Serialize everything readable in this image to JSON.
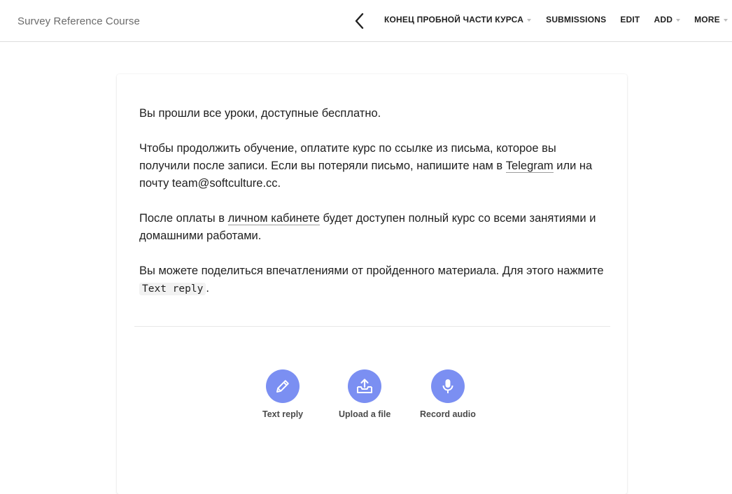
{
  "header": {
    "course_title": "Survey Reference Course",
    "back_icon": "chevron-left-icon",
    "nav": {
      "lesson": "КОНЕЦ ПРОБНОЙ ЧАСТИ КУРСА",
      "submissions": "SUBMISSIONS",
      "edit": "EDIT",
      "add": "ADD",
      "more": "MORE"
    }
  },
  "content": {
    "p1": "Вы прошли все уроки, доступные бесплатно.",
    "p2_before": "Чтобы продолжить обучение, оплатите курс по ссылке из письма, которое вы получили после записи. Если вы потеряли письмо, напишите нам в ",
    "p2_link": "Telegram",
    "p2_after": " или на почту team@softculture.cc.",
    "p3_before": "После оплаты в ",
    "p3_link": "личном кабинете",
    "p3_after": " будет доступен полный курс со всеми занятиями и домашними работами.",
    "p4_before": "Вы можете поделиться впечатлениями от пройденного материала. Для этого нажмите ",
    "p4_code": "Text reply",
    "p4_after": "."
  },
  "actions": {
    "text_reply": "Text reply",
    "upload_file": "Upload a file",
    "record_audio": "Record audio"
  },
  "colors": {
    "accent": "#7b8ff2",
    "text": "#212121",
    "muted": "#6b6b6b"
  }
}
